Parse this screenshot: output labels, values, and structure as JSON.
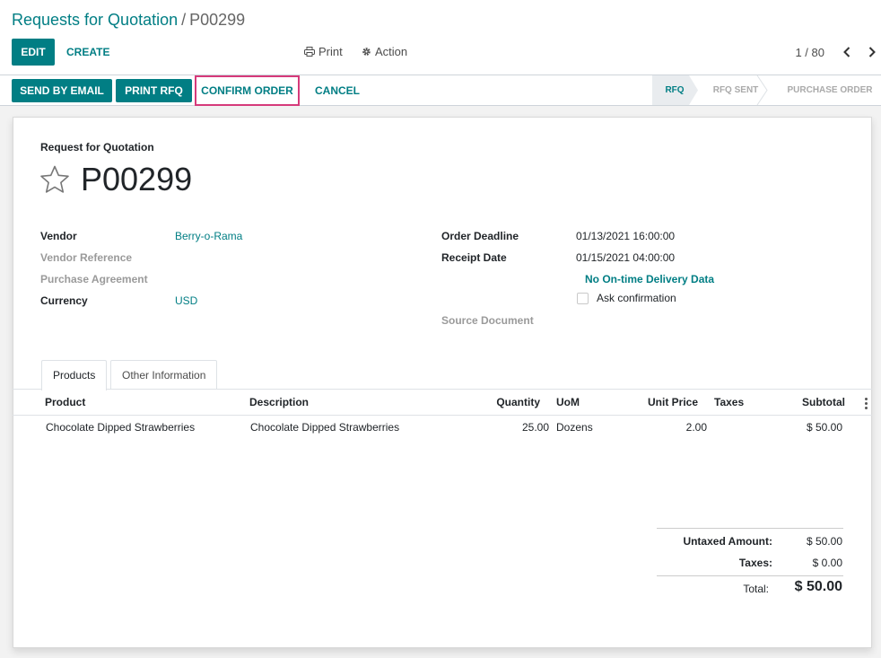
{
  "breadcrumb": {
    "parent": "Requests for Quotation",
    "separator": "/",
    "current": "P00299"
  },
  "control": {
    "edit_label": "EDIT",
    "create_label": "CREATE",
    "print_label": "Print",
    "action_label": "Action",
    "pager": "1 / 80"
  },
  "statusbar": {
    "send_email_label": "SEND BY EMAIL",
    "print_rfq_label": "PRINT RFQ",
    "confirm_label": "CONFIRM ORDER",
    "cancel_label": "CANCEL",
    "stages": [
      "RFQ",
      "RFQ SENT",
      "PURCHASE ORDER"
    ],
    "active_stage": "RFQ"
  },
  "sheet": {
    "type_label": "Request for Quotation",
    "order_name": "P00299"
  },
  "fields_left": [
    {
      "label": "Vendor",
      "value": "Berry-o-Rama",
      "muted": false
    },
    {
      "label": "Vendor Reference",
      "value": "",
      "muted": true
    },
    {
      "label": "Purchase Agreement",
      "value": "",
      "muted": true
    },
    {
      "label": "Currency",
      "value": "USD",
      "muted": false
    }
  ],
  "fields_right": {
    "order_deadline_label": "Order Deadline",
    "order_deadline_value": "01/13/2021 16:00:00",
    "receipt_date_label": "Receipt Date",
    "receipt_date_value": "01/15/2021 04:00:00",
    "delivery_data": "No On-time Delivery Data",
    "ask_confirmation_label": "Ask confirmation",
    "source_document_label": "Source Document"
  },
  "tabs": [
    {
      "label": "Products",
      "active": true
    },
    {
      "label": "Other Information",
      "active": false
    }
  ],
  "table": {
    "columns": [
      "Product",
      "Description",
      "Quantity",
      "UoM",
      "Unit Price",
      "Taxes",
      "Subtotal"
    ],
    "rows": [
      {
        "product": "Chocolate Dipped Strawberries",
        "description": "Chocolate Dipped Strawberries",
        "quantity": "25.00",
        "uom": "Dozens",
        "unit_price": "2.00",
        "taxes": "",
        "subtotal": "$ 50.00"
      }
    ]
  },
  "totals": {
    "untaxed_label": "Untaxed Amount:",
    "untaxed_value": "$ 50.00",
    "taxes_label": "Taxes:",
    "taxes_value": "$ 0.00",
    "total_label": "Total:",
    "total_value": "$ 50.00"
  },
  "colors": {
    "brand": "#017e84",
    "highlight_border": "#d63a7a"
  }
}
